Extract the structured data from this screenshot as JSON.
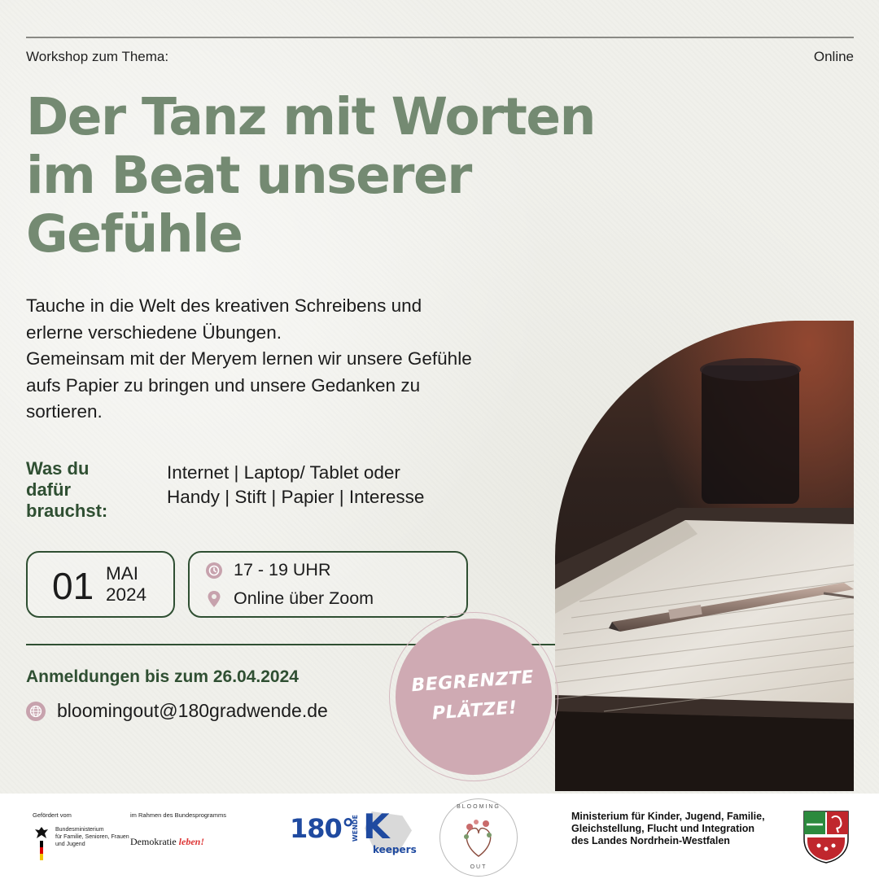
{
  "header": {
    "topic_label": "Workshop zum Thema:",
    "mode": "Online"
  },
  "title": {
    "line1": "Der Tanz mit Worten",
    "line2": "im Beat unserer",
    "line3": "Gefühle"
  },
  "description": [
    "Tauche in die Welt des kreativen Schreibens und",
    "erlerne verschiedene Übungen.",
    "Gemeinsam mit der Meryem lernen wir unsere Gefühle",
    "aufs Papier zu bringen und unsere Gedanken zu",
    "sortieren."
  ],
  "requirements": {
    "label_lines": [
      "Was du",
      "dafür",
      "brauchst:"
    ],
    "items_lines": [
      "Internet | Laptop/ Tablet oder",
      "Handy | Stift | Papier | Interesse"
    ]
  },
  "date": {
    "day": "01",
    "month": "MAI",
    "year": "2024"
  },
  "info": {
    "time": "17 - 19 UHR",
    "location": "Online über Zoom"
  },
  "registration": {
    "deadline": "Anmeldungen bis zum 26.04.2024",
    "email": "bloomingout@180gradwende.de"
  },
  "badge": {
    "line1": "BEGRENZTE",
    "line2": "PLÄTZE!"
  },
  "footer": {
    "funded_by": "Gefördert vom",
    "federal_ministry": [
      "Bundesministerium",
      "für Familie, Senioren, Frauen",
      "und Jugend"
    ],
    "program_intro": "im Rahmen des Bundesprogramms",
    "program_name_a": "Demokratie",
    "program_name_b": "leben!",
    "logo_180": "180°",
    "logo_wende": "WENDE",
    "logo_k": "K",
    "logo_keepers": "keepers",
    "blooming_top": "BLOOMING",
    "blooming_bottom": "OUT",
    "nrw_ministry": [
      "Ministerium für Kinder, Jugend, Familie,",
      "Gleichstellung, Flucht und Integration",
      "des Landes Nordrhein-Westfalen"
    ]
  },
  "colors": {
    "title": "#748a72",
    "accent_dark": "#2f4f32",
    "badge": "#cfaab3",
    "icon": "#c7a2ad"
  },
  "icons": [
    "clock-icon",
    "location-pin-icon",
    "globe-icon",
    "pen-icon",
    "eagle-icon",
    "nrw-crest-icon"
  ]
}
